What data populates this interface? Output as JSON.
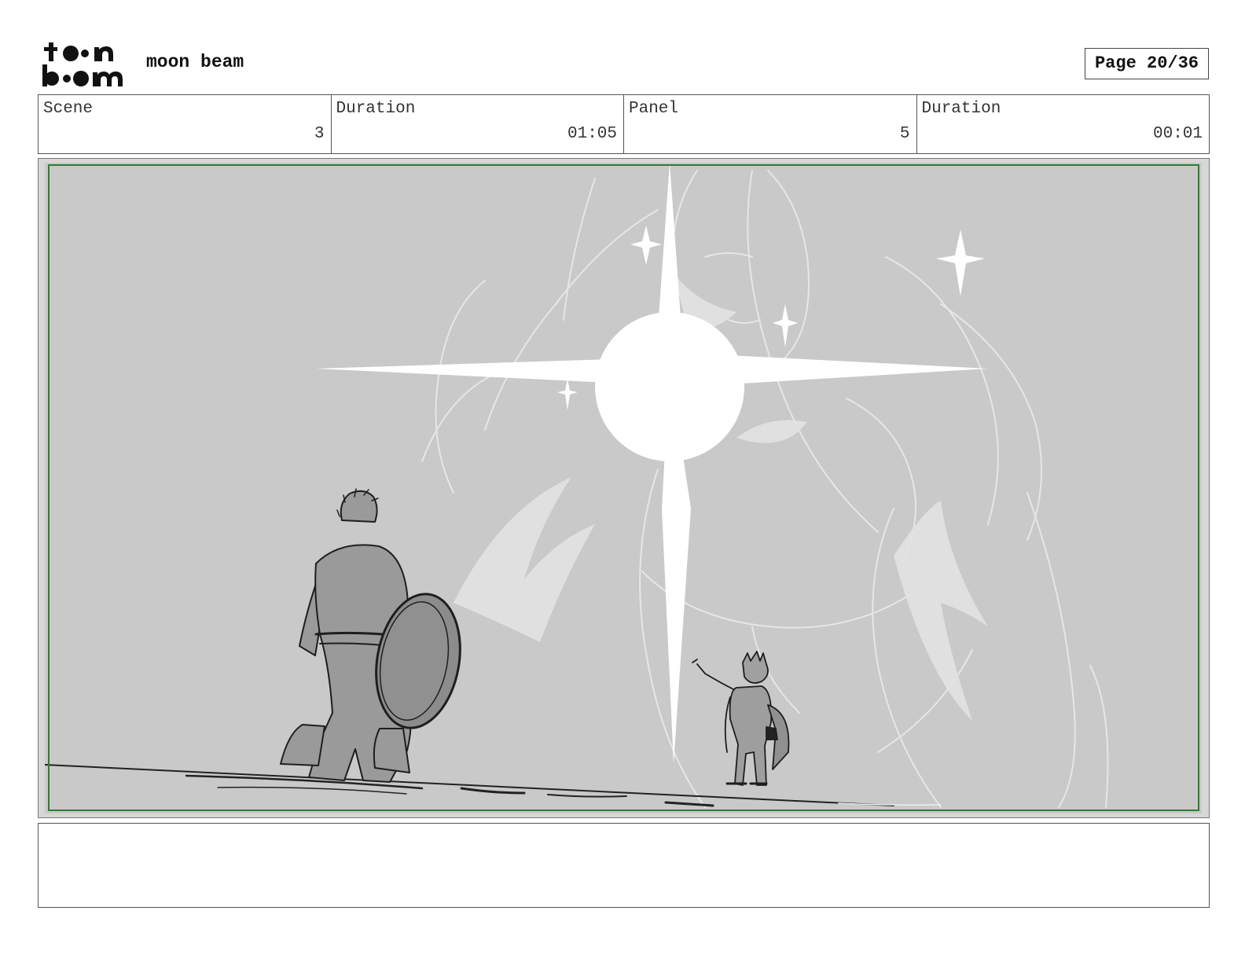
{
  "header": {
    "logo_line1": "toon",
    "logo_line2": "boom",
    "project_title": "moon beam",
    "page_indicator": "Page 20/36"
  },
  "info": {
    "scene_label": "Scene",
    "scene_value": "3",
    "scene_duration_label": "Duration",
    "scene_duration_value": "01:05",
    "panel_label": "Panel",
    "panel_value": "5",
    "panel_duration_label": "Duration",
    "panel_duration_value": "00:01"
  },
  "notes": {
    "text": ""
  },
  "colors": {
    "safe_frame": "#2e7d32",
    "panel_background": "#c8c8c8",
    "glow": "#ffffff"
  }
}
